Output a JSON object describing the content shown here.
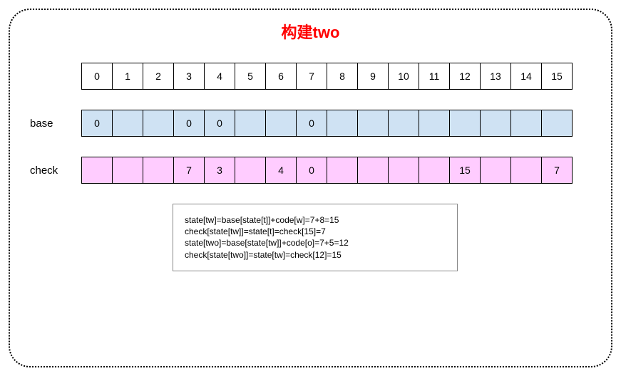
{
  "title": "构建two",
  "labels": {
    "base": "base",
    "check": "check"
  },
  "chart_data": {
    "type": "table",
    "title": "构建two",
    "index": [
      0,
      1,
      2,
      3,
      4,
      5,
      6,
      7,
      8,
      9,
      10,
      11,
      12,
      13,
      14,
      15
    ],
    "base": [
      0,
      null,
      null,
      0,
      0,
      null,
      null,
      0,
      null,
      null,
      null,
      null,
      null,
      null,
      null,
      null
    ],
    "check": [
      null,
      null,
      null,
      7,
      3,
      null,
      4,
      0,
      null,
      null,
      null,
      null,
      15,
      null,
      null,
      7
    ]
  },
  "calc": [
    "state[tw]=base[state[t]]+code[w]=7+8=15",
    "check[state[tw]]=state[t]=check[15]=7",
    "state[two]=base[state[tw]]+code[o]=7+5=12",
    "check[state[two]]=state[tw]=check[12]=15"
  ]
}
